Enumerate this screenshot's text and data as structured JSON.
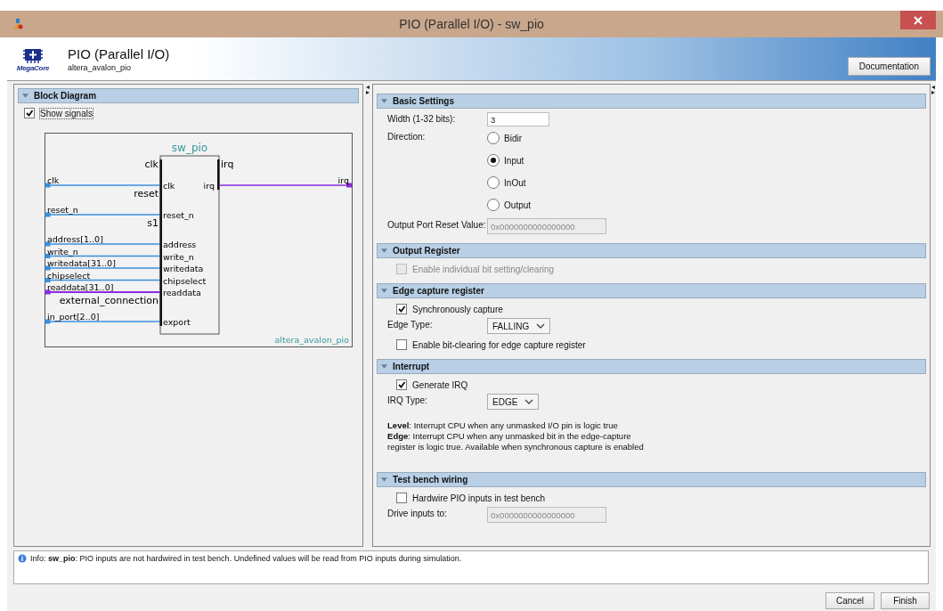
{
  "window": {
    "title": "PIO (Parallel I/O) - sw_pio"
  },
  "header": {
    "title": "PIO (Parallel I/O)",
    "subtitle": "altera_avalon_pio",
    "logo_caption": "MegaCore",
    "documentation_button": "Documentation"
  },
  "block_diagram": {
    "title": "Block Diagram",
    "show_signals": {
      "label": "Show signals",
      "checked": true
    },
    "diagram": {
      "instance": "sw_pio",
      "module": "altera_avalon_pio",
      "left_interfaces": [
        {
          "name": "clk",
          "ports": [
            {
              "signal": "clk",
              "port": "clk",
              "kind": "input"
            }
          ]
        },
        {
          "name": "reset",
          "ports": [
            {
              "signal": "reset_n",
              "port": "reset_n",
              "kind": "input"
            }
          ]
        },
        {
          "name": "s1",
          "ports": [
            {
              "signal": "address[1..0]",
              "port": "address",
              "kind": "input"
            },
            {
              "signal": "write_n",
              "port": "write_n",
              "kind": "input"
            },
            {
              "signal": "writedata[31..0]",
              "port": "writedata",
              "kind": "input"
            },
            {
              "signal": "chipselect",
              "port": "chipselect",
              "kind": "input"
            },
            {
              "signal": "readdata[31..0]",
              "port": "readdata",
              "kind": "output"
            }
          ]
        },
        {
          "name": "external_connection",
          "ports": [
            {
              "signal": "in_port[2..0]",
              "port": "export",
              "kind": "input"
            }
          ]
        }
      ],
      "right_interfaces": [
        {
          "name": "irq",
          "ports": [
            {
              "signal": "irq",
              "port": "irq",
              "kind": "output"
            }
          ]
        }
      ]
    }
  },
  "sections": [
    {
      "title": "Basic Settings",
      "rows": [
        {
          "kind": "field",
          "label": "Width (1-32 bits):",
          "value": "3",
          "disabled": false
        },
        {
          "kind": "radio",
          "label": "Direction:",
          "options": [
            {
              "label": "Bidir",
              "selected": false
            },
            {
              "label": "Input",
              "selected": true
            },
            {
              "label": "InOut",
              "selected": false
            },
            {
              "label": "Output",
              "selected": false
            }
          ]
        },
        {
          "kind": "field",
          "label": "Output Port Reset Value:",
          "value": "0x0000000000000000",
          "disabled": true
        }
      ]
    },
    {
      "title": "Output Register",
      "rows": [
        {
          "kind": "checkbox",
          "label": "Enable individual bit setting/clearing",
          "checked": false,
          "disabled": true
        }
      ]
    },
    {
      "title": "Edge capture register",
      "rows": [
        {
          "kind": "checkbox",
          "label": "Synchronously capture",
          "checked": true,
          "disabled": false
        },
        {
          "kind": "select",
          "label": "Edge Type:",
          "value": "FALLING"
        },
        {
          "kind": "checkbox",
          "label": "Enable bit-clearing for edge capture register",
          "checked": false,
          "disabled": false
        }
      ]
    },
    {
      "title": "Interrupt",
      "rows": [
        {
          "kind": "checkbox",
          "label": "Generate IRQ",
          "checked": true,
          "disabled": false
        },
        {
          "kind": "select",
          "label": "IRQ Type:",
          "value": "EDGE"
        },
        {
          "kind": "note",
          "lines": [
            "**Level**: Interrupt CPU when any unmasked I/O pin is logic true",
            "**Edge**: Interrupt CPU when any unmasked bit in the edge-capture",
            "register is logic true. Available when synchronous capture is enabled"
          ]
        }
      ]
    },
    {
      "title": "Test bench wiring",
      "rows": [
        {
          "kind": "checkbox",
          "label": "Hardwire PIO inputs in test bench",
          "checked": false,
          "disabled": false
        },
        {
          "kind": "field",
          "label": "Drive inputs to:",
          "value": "0x0000000000000000",
          "disabled": true
        }
      ]
    }
  ],
  "messages": [
    {
      "text": "Info: **sw_pio**: PIO inputs are not hardwired in test bench. Undefined values will be read from PIO inputs during simulation."
    }
  ],
  "buttons": [
    "Cancel",
    "Finish"
  ]
}
